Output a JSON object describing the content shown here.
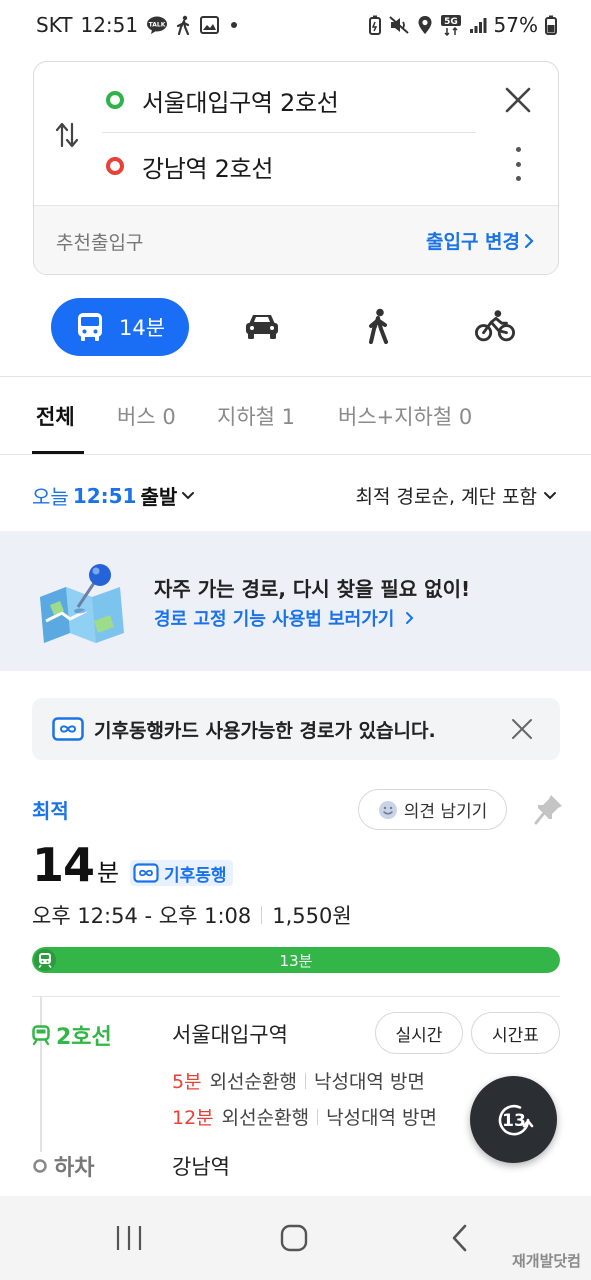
{
  "status_bar": {
    "carrier": "SKT",
    "time": "12:51",
    "network": "5G",
    "battery": "57%",
    "talk_badge": "TALK"
  },
  "route": {
    "origin": "서울대입구역 2호선",
    "destination": "강남역 2호선",
    "entrance_label": "추천출입구",
    "entrance_change": "출입구 변경"
  },
  "modes": {
    "transit_time": "14분"
  },
  "filter_tabs": [
    {
      "label": "전체"
    },
    {
      "label": "버스 0"
    },
    {
      "label": "지하철 1"
    },
    {
      "label": "버스+지하철 0"
    }
  ],
  "departure": {
    "day": "오늘",
    "time": "12:51",
    "suffix": "출발",
    "sort": "최적 경로순, 계단 포함"
  },
  "banner": {
    "title": "자주 가는 경로, 다시 찾을 필요 없이!",
    "link": "경로 고정 기능 사용법 보러가기"
  },
  "notice": {
    "text": "기후동행카드 사용가능한 경로가 있습니다."
  },
  "result": {
    "best_label": "최적",
    "feedback": "의견 남기기",
    "duration_num": "14",
    "duration_unit": "분",
    "climate_badge": "기후동행",
    "time_range": "오후 12:54 - 오후 1:08",
    "fare": "1,550원",
    "segment_label": "13분",
    "segment_fraction": 1.0,
    "line_name": "2호선",
    "board_station": "서울대입구역",
    "realtime_btn": "실시간",
    "timetable_btn": "시간표",
    "arrivals": [
      {
        "mins": "5분",
        "direction": "외선순환행",
        "heading": "낙성대역 방면"
      },
      {
        "mins": "12분",
        "direction": "외선순환행",
        "heading": "낙성대역 방면"
      }
    ],
    "alight_label": "하차",
    "alight_station": "강남역",
    "fab_number": "13"
  },
  "watermark": "재개발닷컴",
  "colors": {
    "accent_blue": "#1a6ef5",
    "line2_green": "#33b548",
    "origin_green": "#2db34a",
    "dest_red": "#e84135"
  }
}
